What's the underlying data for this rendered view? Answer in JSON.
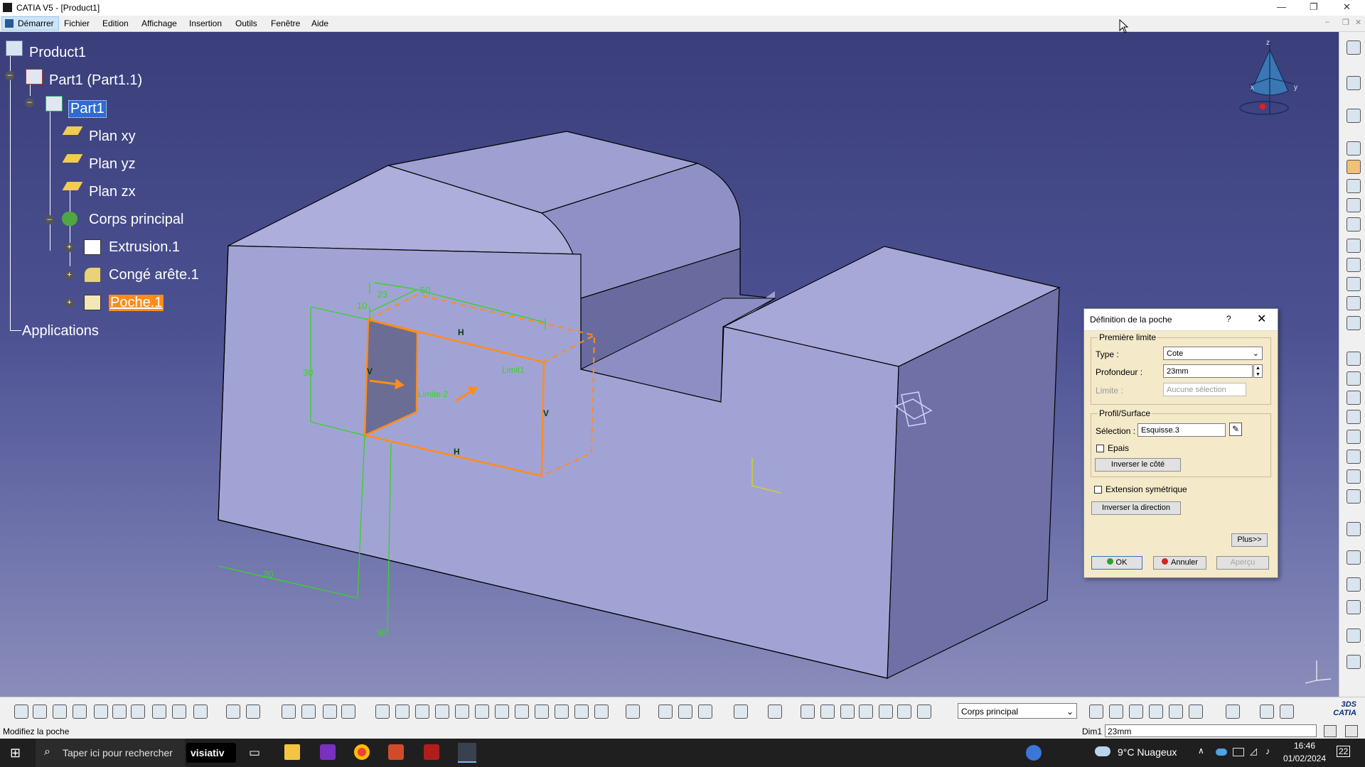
{
  "window": {
    "title": "CATIA V5 - [Product1]",
    "controls": [
      "—",
      "❐",
      "✕"
    ]
  },
  "menu": {
    "start": "Démarrer",
    "items": [
      "Fichier",
      "Edition",
      "Affichage",
      "Insertion",
      "Outils",
      "Fenêtre",
      "Aide"
    ]
  },
  "tree": {
    "product": "Product1",
    "part_instance": "Part1 (Part1.1)",
    "part": "Part1",
    "plane_xy": "Plan xy",
    "plane_yz": "Plan yz",
    "plane_zx": "Plan zx",
    "body": "Corps principal",
    "extrusion": "Extrusion.1",
    "fillet": "Congé arête.1",
    "pocket": "Poche.1",
    "applications": "Applications"
  },
  "viewport_labels": {
    "dim_23": "23",
    "dim_50": "50",
    "dim_30": "30",
    "dim_20": "20",
    "dim_90": "90",
    "dim_10": "10",
    "h_top": "H",
    "h_bottom": "H",
    "v_left": "V",
    "v_right": "V",
    "limit1": "Limit1",
    "limit2": "Limite 2",
    "compass_x": "x",
    "compass_y": "y",
    "compass_z": "z"
  },
  "dialog": {
    "title": "Définition de la poche",
    "help": "?",
    "close": "✕",
    "first_limit_group": "Première limite",
    "type_label": "Type :",
    "type_value": "Cote",
    "depth_label": "Profondeur :",
    "depth_value": "23mm",
    "limit_label": "Limite :",
    "limit_value": "Aucune sélection",
    "profile_group": "Profil/Surface",
    "selection_label": "Sélection :",
    "selection_value": "Esquisse.3",
    "thick_label": "Epais",
    "invert_side": "Inverser le côté",
    "sym_label": "Extension symétrique",
    "invert_direction": "Inverser la direction",
    "more": "Plus>>",
    "ok": "OK",
    "cancel": "Annuler",
    "preview": "Aperçu"
  },
  "bottom_toolbar": {
    "body_select": "Corps principal"
  },
  "status": {
    "message": "Modifiez la poche",
    "dim_label": "Dim1",
    "dim_value": "23mm"
  },
  "taskbar": {
    "search": "Taper ici pour rechercher",
    "brand": "visiativ",
    "weather": "9°C  Nuageux",
    "time": "16:46",
    "date": "01/02/2024",
    "notif": "22"
  },
  "colors": {
    "viewport_top": "#3a3e7a",
    "part_face": "#a9aad8",
    "edit_orange": "#ff8c1a",
    "sketch_green": "#3bd12b",
    "dialog_bg": "#f4e9c9"
  }
}
